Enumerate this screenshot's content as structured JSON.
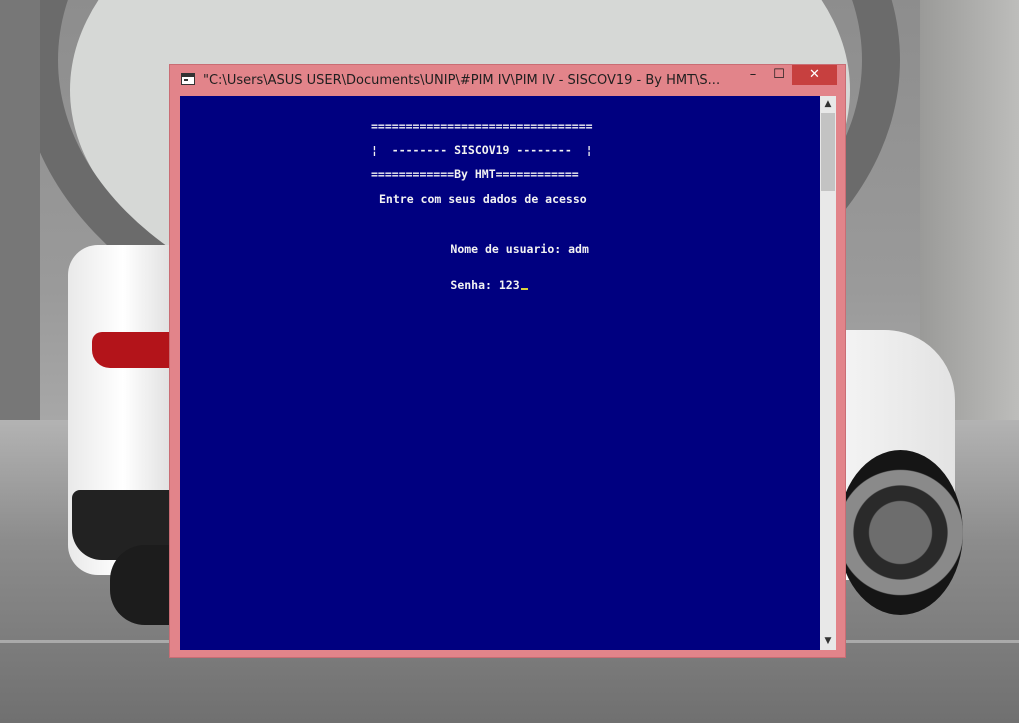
{
  "window": {
    "title": "\"C:\\Users\\ASUS USER\\Documents\\UNIP\\#PIM IV\\PIM IV - SISCOV19 - By HMT\\S...",
    "minimize_glyph": "–",
    "maximize_glyph": "☐",
    "close_glyph": "✕"
  },
  "scrollbar": {
    "up_glyph": "▲",
    "down_glyph": "▼"
  },
  "console": {
    "banner_top": "================================",
    "banner_middle": "¦  -------- SISCOV19 --------  ¦",
    "banner_bottom": "============By HMT============",
    "prompt_heading": "Entre com seus dados de acesso",
    "username_label": "Nome de usuario: ",
    "username_value": "adm",
    "password_label": "Senha: ",
    "password_value": "123"
  },
  "colors": {
    "console_background": "#000080",
    "console_text": "#f2f2f2",
    "window_frame": "#e2848a",
    "close_button": "#c7403f"
  }
}
